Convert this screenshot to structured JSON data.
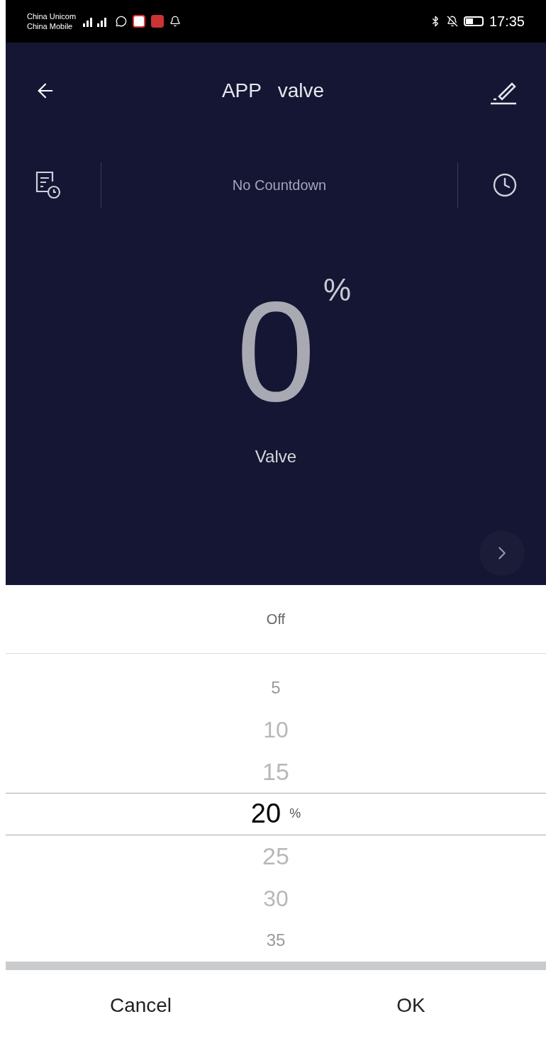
{
  "status_bar": {
    "carriers": [
      "China Unicom",
      "China Mobile"
    ],
    "time": "17:35"
  },
  "header": {
    "title": "APP   valve"
  },
  "countdown": {
    "label": "No Countdown"
  },
  "reading": {
    "value": "0",
    "unit": "%",
    "label": "Valve"
  },
  "picker": {
    "top_option": "Off",
    "unit": "%",
    "items": [
      {
        "label": "5",
        "selected": false
      },
      {
        "label": "10",
        "selected": false
      },
      {
        "label": "15",
        "selected": false
      },
      {
        "label": "20",
        "selected": true
      },
      {
        "label": "25",
        "selected": false
      },
      {
        "label": "30",
        "selected": false
      },
      {
        "label": "35",
        "selected": false
      }
    ]
  },
  "buttons": [
    {
      "label": "Cancel"
    },
    {
      "label": "OK"
    }
  ]
}
